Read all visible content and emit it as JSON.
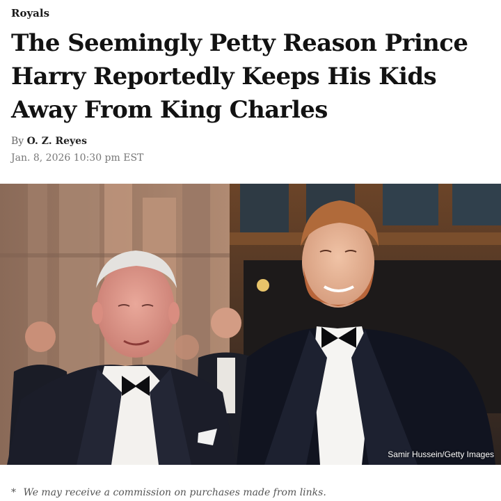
{
  "article": {
    "category": "Royals",
    "headline": "The Seemingly Petty Reason Prince Harry Reportedly Keeps His Kids Away From King Charles",
    "byline_prefix": "By",
    "author": "O. Z. Reyes",
    "date": "Jan. 8, 2026 10:30 pm EST"
  },
  "hero_image": {
    "credit": "Samir Hussein/Getty Images"
  },
  "disclaimer": {
    "marker": "*",
    "text": "We may receive a commission on purchases made from links."
  }
}
